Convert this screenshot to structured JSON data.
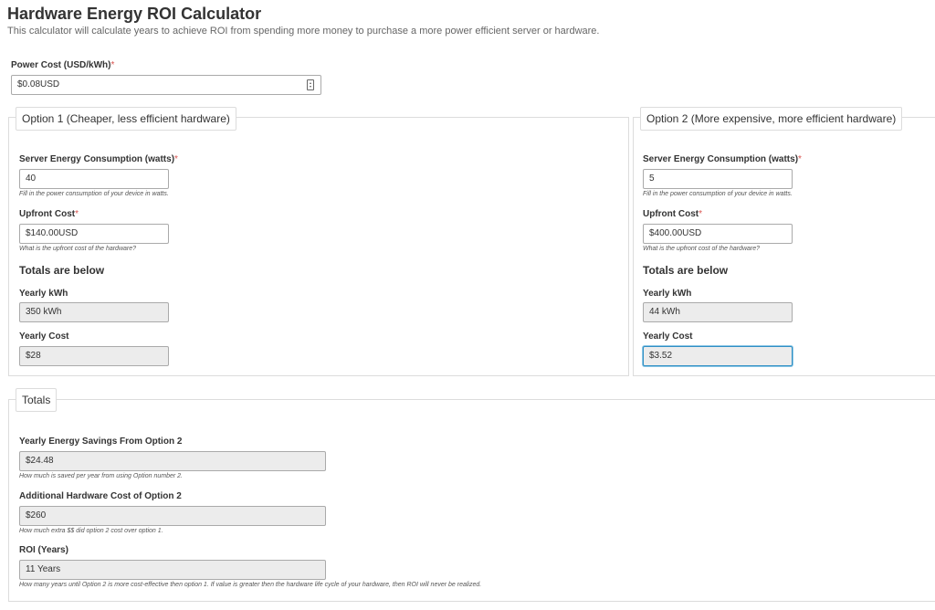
{
  "header": {
    "title": "Hardware Energy ROI Calculator",
    "subtitle": "This calculator will calculate years to achieve ROI from spending more money to purchase a more power efficient server or hardware."
  },
  "power_cost": {
    "label": "Power Cost (USD/kWh)",
    "required_mark": "*",
    "value": "$0.08USD"
  },
  "option1": {
    "legend": "Option 1 (Cheaper, less efficient hardware)",
    "energy_label": "Server Energy Consumption (watts)",
    "energy_value": "40",
    "energy_help": "Fill in the power consumption of your device in watts.",
    "upfront_label": "Upfront Cost",
    "upfront_value": "$140.00USD",
    "upfront_help": "What is the upfront cost of the hardware?",
    "totals_heading": "Totals are below",
    "yearly_kwh_label": "Yearly kWh",
    "yearly_kwh_value": "350 kWh",
    "yearly_cost_label": "Yearly Cost",
    "yearly_cost_value": "$28"
  },
  "option2": {
    "legend": "Option 2 (More expensive, more efficient hardware)",
    "energy_label": "Server Energy Consumption (watts)",
    "energy_value": "5",
    "energy_help": "Fill in the power consumption of your device in watts.",
    "upfront_label": "Upfront Cost",
    "upfront_value": "$400.00USD",
    "upfront_help": "What is the upfront cost of the hardware?",
    "totals_heading": "Totals are below",
    "yearly_kwh_label": "Yearly kWh",
    "yearly_kwh_value": "44 kWh",
    "yearly_cost_label": "Yearly Cost",
    "yearly_cost_value": "$3.52"
  },
  "totals": {
    "legend": "Totals",
    "savings_label": "Yearly Energy Savings From Option 2",
    "savings_value": "$24.48",
    "savings_help": "How much is saved per year from using Option number 2.",
    "extra_cost_label": "Additional Hardware Cost of Option 2",
    "extra_cost_value": "$260",
    "extra_cost_help": "How much extra $$ did option 2 cost over option 1.",
    "roi_label": "ROI (Years)",
    "roi_value": "11 Years",
    "roi_help": "How many years until Option 2 is more cost-effective then option 1. If value is greater then the hardware life cycle of your hardware, then ROI will never be realized."
  },
  "icons": {
    "power_cost_spinner": "number-spinner-icon"
  },
  "colors": {
    "required": "#d9534f",
    "focus_border": "#2f8fc4",
    "readonly_bg": "#ececec"
  }
}
